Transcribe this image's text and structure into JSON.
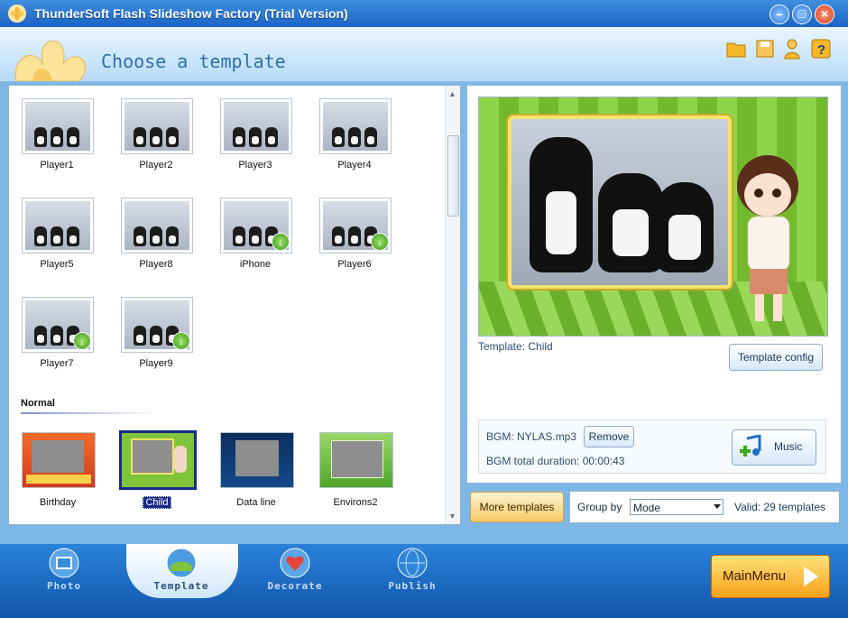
{
  "window": {
    "title": "ThunderSoft Flash Slideshow Factory (Trial Version)"
  },
  "header": {
    "heading": "Choose a template"
  },
  "templates": {
    "player_items": [
      {
        "label": "Player1",
        "download": false
      },
      {
        "label": "Player2",
        "download": false
      },
      {
        "label": "Player3",
        "download": false
      },
      {
        "label": "Player4",
        "download": false
      },
      {
        "label": "Player5",
        "download": false
      },
      {
        "label": "Player8",
        "download": false
      },
      {
        "label": "iPhone",
        "download": true
      },
      {
        "label": "Player6",
        "download": true
      },
      {
        "label": "Player7",
        "download": true
      },
      {
        "label": "Player9",
        "download": true
      }
    ],
    "section_normal": "Normal",
    "normal_items": [
      {
        "label": "Birthday",
        "selected": false
      },
      {
        "label": "Child",
        "selected": true
      },
      {
        "label": "Data line",
        "selected": false
      },
      {
        "label": "Environs2",
        "selected": false
      }
    ]
  },
  "preview": {
    "template_label": "Template:  Child",
    "template_config": "Template config"
  },
  "bgm": {
    "file": "BGM: NYLAS.mp3",
    "remove": "Remove",
    "duration": "BGM total duration: 00:00:43",
    "music": "Music"
  },
  "footer": {
    "more_templates": "More templates",
    "group_by_label": "Group by",
    "group_by_value": "Mode",
    "valid": "Valid: 29 templates"
  },
  "nav": {
    "photo": "Photo",
    "template": "Template",
    "decorate": "Decorate",
    "publish": "Publish",
    "active": "Template"
  },
  "main_menu": "MainMenu",
  "colors": {
    "accent": "#1c63c4",
    "selected": "#1a2a8a",
    "mainmenu": "#f7a11a"
  }
}
